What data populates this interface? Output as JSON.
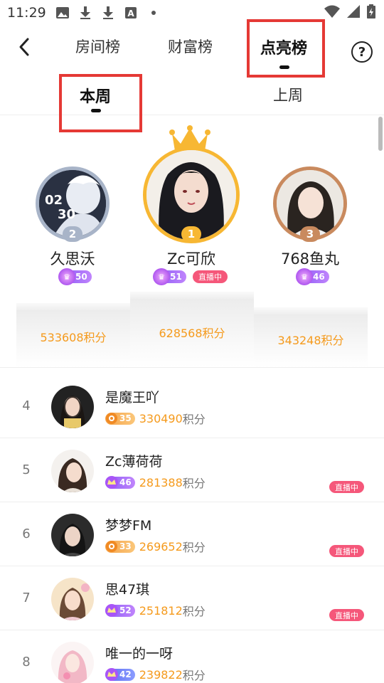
{
  "status_bar": {
    "time": "11:29",
    "icons": [
      "image-icon",
      "download-icon",
      "download-icon",
      "font-icon",
      "dot-icon"
    ],
    "right_icons": [
      "wifi-icon",
      "signal-icon",
      "battery-icon"
    ]
  },
  "header": {
    "tabs": [
      {
        "label": "房间榜",
        "active": false
      },
      {
        "label": "财富榜",
        "active": false
      },
      {
        "label": "点亮榜",
        "active": true
      }
    ],
    "help": "?"
  },
  "week_tabs": [
    {
      "label": "本周",
      "active": true
    },
    {
      "label": "上周",
      "active": false
    }
  ],
  "podium": [
    {
      "rank": "2",
      "name": "久思沃",
      "level": "50",
      "level_type": "purple",
      "score": "533608积分",
      "live": null
    },
    {
      "rank": "1",
      "name": "Zc可欣",
      "level": "51",
      "level_type": "purple",
      "score": "628568积分",
      "live": "直播中"
    },
    {
      "rank": "3",
      "name": "768鱼丸",
      "level": "46",
      "level_type": "purple",
      "score": "343248积分",
      "live": null
    }
  ],
  "list": [
    {
      "rank": "4",
      "name": "是魔王吖",
      "level": "35",
      "level_type": "orange",
      "score": "330490",
      "unit": "积分",
      "live": null
    },
    {
      "rank": "5",
      "name": "Zc薄荷荷",
      "level": "46",
      "level_type": "purple",
      "score": "281388",
      "unit": "积分",
      "live": "直播中"
    },
    {
      "rank": "6",
      "name": "梦梦FM",
      "level": "33",
      "level_type": "orange",
      "score": "269652",
      "unit": "积分",
      "live": "直播中"
    },
    {
      "rank": "7",
      "name": "思47琪",
      "level": "52",
      "level_type": "purple",
      "score": "251812",
      "unit": "积分",
      "live": "直播中"
    },
    {
      "rank": "8",
      "name": "唯一的一呀",
      "level": "42",
      "level_type": "blue",
      "score": "239822",
      "unit": "积分",
      "live": null
    }
  ],
  "colors": {
    "accent_orange": "#f59a1c",
    "live_pink": "#f5577a",
    "gold": "#f7b733",
    "silver": "#a8b4c8",
    "bronze": "#c98a5e",
    "highlight_red": "#e53935"
  }
}
